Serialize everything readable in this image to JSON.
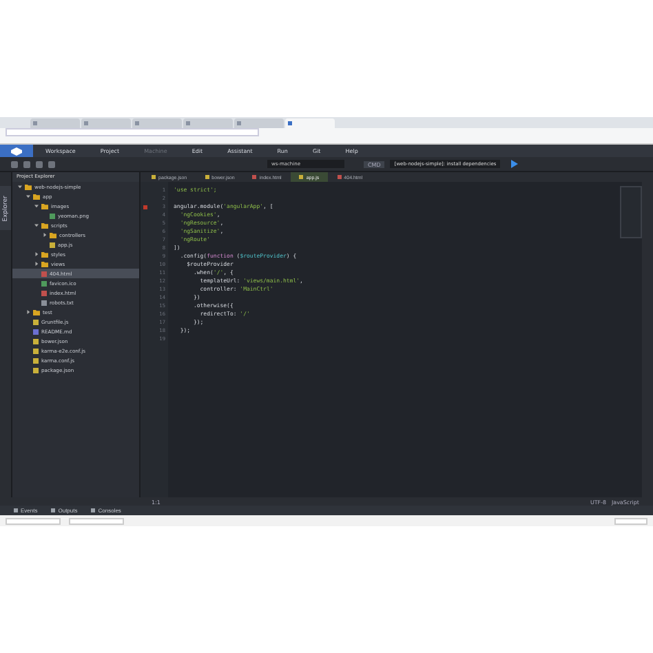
{
  "browser": {
    "tabs": [
      {
        "selected": false
      },
      {
        "selected": false
      },
      {
        "selected": false
      },
      {
        "selected": false
      },
      {
        "selected": false
      },
      {
        "selected": true
      }
    ]
  },
  "menu": [
    {
      "label": "Workspace",
      "disabled": false
    },
    {
      "label": "Project",
      "disabled": false
    },
    {
      "label": "Machine",
      "disabled": true
    },
    {
      "label": "Edit",
      "disabled": false
    },
    {
      "label": "Assistant",
      "disabled": false
    },
    {
      "label": "Run",
      "disabled": false
    },
    {
      "label": "Git",
      "disabled": false
    },
    {
      "label": "Help",
      "disabled": false
    }
  ],
  "toolbar": {
    "machine": "ws-machine",
    "command_badge": "CMD",
    "command": "[web-nodejs-simple]: install dependencies"
  },
  "explorer": {
    "title": "Project Explorer",
    "side_tab": "Explorer",
    "tree": [
      {
        "name": "web-nodejs-simple",
        "kind": "folder",
        "expanded": true,
        "selected": false,
        "children": [
          {
            "name": "app",
            "kind": "folder",
            "expanded": true,
            "selected": false,
            "children": [
              {
                "name": "images",
                "kind": "folder",
                "expanded": true,
                "selected": false,
                "children": [
                  {
                    "name": "yeoman.png",
                    "kind": "image",
                    "selected": false
                  }
                ]
              },
              {
                "name": "scripts",
                "kind": "folder",
                "expanded": true,
                "selected": false,
                "children": [
                  {
                    "name": "controllers",
                    "kind": "folder",
                    "expanded": false,
                    "selected": false
                  },
                  {
                    "name": "app.js",
                    "kind": "js",
                    "selected": false
                  }
                ]
              },
              {
                "name": "styles",
                "kind": "folder",
                "expanded": false,
                "selected": false
              },
              {
                "name": "views",
                "kind": "folder",
                "expanded": false,
                "selected": false
              },
              {
                "name": "404.html",
                "kind": "html",
                "selected": true
              },
              {
                "name": "favicon.ico",
                "kind": "image",
                "selected": false
              },
              {
                "name": "index.html",
                "kind": "html",
                "selected": false
              },
              {
                "name": "robots.txt",
                "kind": "text",
                "selected": false
              }
            ]
          },
          {
            "name": "test",
            "kind": "folder",
            "expanded": false,
            "selected": false
          },
          {
            "name": "Gruntfile.js",
            "kind": "js",
            "selected": false
          },
          {
            "name": "README.md",
            "kind": "md",
            "selected": false
          },
          {
            "name": "bower.json",
            "kind": "json",
            "selected": false
          },
          {
            "name": "karma-e2e.conf.js",
            "kind": "js",
            "selected": false
          },
          {
            "name": "karma.conf.js",
            "kind": "js",
            "selected": false
          },
          {
            "name": "package.json",
            "kind": "json",
            "selected": false
          }
        ]
      }
    ]
  },
  "editor": {
    "tabs": [
      {
        "label": "package.json",
        "kind": "json",
        "selected": false
      },
      {
        "label": "bower.json",
        "kind": "json",
        "selected": false
      },
      {
        "label": "index.html",
        "kind": "html",
        "selected": false
      },
      {
        "label": "app.js",
        "kind": "js",
        "selected": true
      },
      {
        "label": "404.html",
        "kind": "html",
        "selected": false
      }
    ],
    "lines": [
      {
        "number": "1",
        "error": false,
        "tokens": [
          {
            "text": "'use strict';",
            "kind": "string"
          }
        ]
      },
      {
        "number": "2",
        "error": false
      },
      {
        "number": "3",
        "error": true,
        "tokens": [
          {
            "text": "angular.module(",
            "kind": "plain"
          },
          {
            "text": "'angularApp'",
            "kind": "string"
          },
          {
            "text": ", [",
            "kind": "plain"
          }
        ]
      },
      {
        "number": "4",
        "error": false,
        "tokens": [
          {
            "text": "  'ngCookies'",
            "kind": "string"
          },
          {
            "text": ",",
            "kind": "plain"
          }
        ]
      },
      {
        "number": "5",
        "error": false,
        "tokens": [
          {
            "text": "  'ngResource'",
            "kind": "string"
          },
          {
            "text": ",",
            "kind": "plain"
          }
        ]
      },
      {
        "number": "6",
        "error": false,
        "tokens": [
          {
            "text": "  'ngSanitize'",
            "kind": "string"
          },
          {
            "text": ",",
            "kind": "plain"
          }
        ]
      },
      {
        "number": "7",
        "error": false,
        "tokens": [
          {
            "text": "  'ngRoute'",
            "kind": "string"
          }
        ]
      },
      {
        "number": "8",
        "error": false,
        "tokens": [
          {
            "text": "])",
            "kind": "plain"
          }
        ]
      },
      {
        "number": "9",
        "error": false,
        "tokens": [
          {
            "text": "  .config(",
            "kind": "plain"
          },
          {
            "text": "function",
            "kind": "keyword"
          },
          {
            "text": " (",
            "kind": "plain"
          },
          {
            "text": "$routeProvider",
            "kind": "param"
          },
          {
            "text": ") {",
            "kind": "plain"
          }
        ]
      },
      {
        "number": "10",
        "error": false,
        "tokens": [
          {
            "text": "    $routeProvider",
            "kind": "plain"
          }
        ]
      },
      {
        "number": "11",
        "error": false,
        "tokens": [
          {
            "text": "      .when(",
            "kind": "plain"
          },
          {
            "text": "'/'",
            "kind": "string"
          },
          {
            "text": ", {",
            "kind": "plain"
          }
        ]
      },
      {
        "number": "12",
        "error": false,
        "tokens": [
          {
            "text": "        templateUrl: ",
            "kind": "plain"
          },
          {
            "text": "'views/main.html'",
            "kind": "string"
          },
          {
            "text": ",",
            "kind": "plain"
          }
        ]
      },
      {
        "number": "13",
        "error": false,
        "tokens": [
          {
            "text": "        controller: ",
            "kind": "plain"
          },
          {
            "text": "'MainCtrl'",
            "kind": "string"
          }
        ]
      },
      {
        "number": "14",
        "error": false,
        "tokens": [
          {
            "text": "      })",
            "kind": "plain"
          }
        ]
      },
      {
        "number": "15",
        "error": false,
        "tokens": [
          {
            "text": "      .otherwise({",
            "kind": "plain"
          }
        ]
      },
      {
        "number": "16",
        "error": false,
        "tokens": [
          {
            "text": "        redirectTo: ",
            "kind": "plain"
          },
          {
            "text": "'/'",
            "kind": "string"
          }
        ]
      },
      {
        "number": "17",
        "error": false,
        "tokens": [
          {
            "text": "      });",
            "kind": "plain"
          }
        ]
      },
      {
        "number": "18",
        "error": false,
        "tokens": [
          {
            "text": "  });",
            "kind": "plain"
          }
        ]
      },
      {
        "number": "19",
        "error": false
      }
    ]
  },
  "status": {
    "position": "1:1",
    "encoding": "UTF-8",
    "language": "JavaScript"
  },
  "bottom_tabs": [
    "Events",
    "Outputs",
    "Consoles"
  ]
}
